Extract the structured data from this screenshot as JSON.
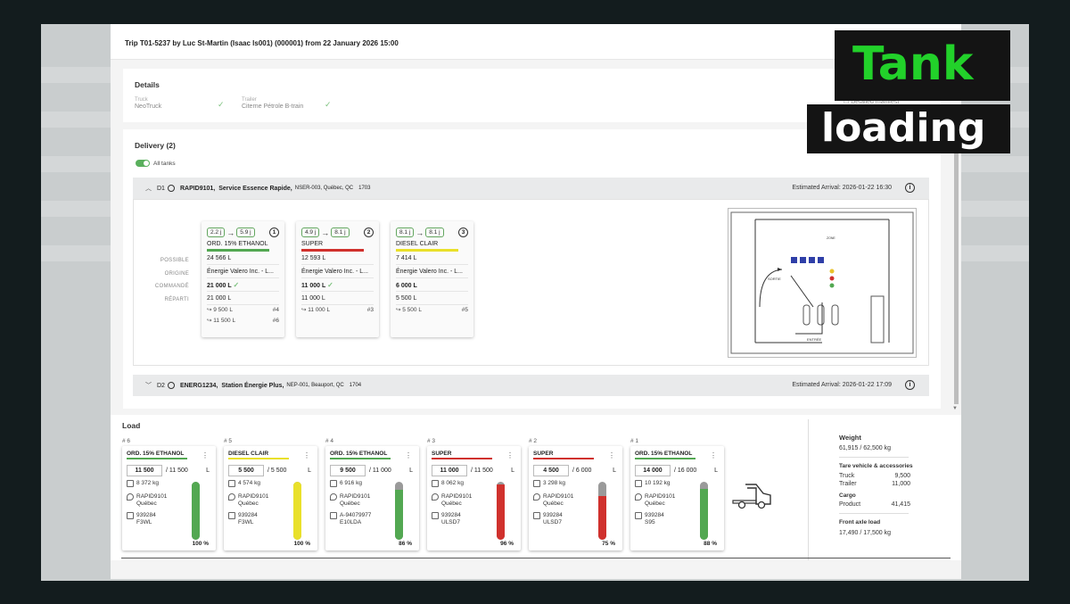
{
  "title": "Trip T01-5237 by Luc St-Martin (Isaac ls001) (000001) from 22 January 2026 15:00",
  "details": {
    "heading": "Details",
    "truck_label": "Truck",
    "truck_value": "NeoTruck",
    "trailer_label": "Trailer",
    "trailer_value": "Citerne Pétrole B-train",
    "manifest": "Detailed manifest"
  },
  "delivery": {
    "heading": "Delivery (2)",
    "all_tanks": "All tanks",
    "d1": {
      "id": "D1",
      "code": "RAPID9101,",
      "name": "Service Essence Rapide,",
      "address": "NSER-003, Québec, QC",
      "num": "1703",
      "eta": "Estimated Arrival: 2026-01-22 16:30"
    },
    "d2": {
      "id": "D2",
      "code": "ENERG1234,",
      "name": "Station Énergie Plus,",
      "address": "NEP-001, Beauport, QC",
      "num": "1704",
      "eta": "Estimated Arrival: 2026-01-22 17:09"
    },
    "row_labels": {
      "possible": "POSSIBLE",
      "origin": "ORIGINE",
      "ordered": "COMMANDÉ",
      "distributed": "RÉPARTI"
    },
    "tanks": [
      {
        "from": "2.2 j",
        "to": "5.9 j",
        "no": "1",
        "product": "ORD. 15% ETHANOL",
        "color": "#53a852",
        "possible": "24 566 L",
        "origin": "Énergie Valero Inc. - L...",
        "ordered": "21 000 L",
        "ordered_ok": "✓",
        "distributed": "21 000 L",
        "splits": [
          {
            "qty": "9 500 L",
            "tag": "#4"
          },
          {
            "qty": "11 500 L",
            "tag": "#6"
          }
        ]
      },
      {
        "from": "4.9 j",
        "to": "8.1 j",
        "no": "2",
        "product": "SUPER",
        "color": "#d0312d",
        "possible": "12 593 L",
        "origin": "Énergie Valero Inc. - L...",
        "ordered": "11 000 L",
        "ordered_ok": "✓",
        "distributed": "11 000 L",
        "splits": [
          {
            "qty": "11 000 L",
            "tag": "#3"
          }
        ]
      },
      {
        "from": "8.1 j",
        "to": "8.1 j",
        "no": "3",
        "product": "DIESEL CLAIR",
        "color": "#e9e02a",
        "possible": "7 414 L",
        "origin": "Énergie Valero Inc. - L...",
        "ordered": "6 000 L",
        "ordered_ok": "",
        "distributed": "5 500 L",
        "splits": [
          {
            "qty": "5 500 L",
            "tag": "#5"
          }
        ]
      }
    ],
    "map_labels": {
      "in": "ENTRÉE",
      "out": "SORTIE",
      "ref": "ZONE"
    }
  },
  "load": {
    "heading": "Load",
    "compartments": [
      {
        "num": "# 6",
        "product": "ORD. 15% ETHANOL",
        "color": "#53a852",
        "qty": "11 500",
        "cap": "/ 11 500",
        "unit": "L",
        "kg": "8 372 kg",
        "site": "RAPID9101",
        "city": "Québec",
        "doc": "939284",
        "code": "F3WL",
        "pct": "100 %",
        "level": 1.0
      },
      {
        "num": "# 5",
        "product": "DIESEL CLAIR",
        "color": "#e9e02a",
        "qty": "5 500",
        "cap": "/ 5 500",
        "unit": "L",
        "kg": "4 574 kg",
        "site": "RAPID9101",
        "city": "Québec",
        "doc": "939284",
        "code": "F3WL",
        "pct": "100 %",
        "level": 1.0
      },
      {
        "num": "# 4",
        "product": "ORD. 15% ETHANOL",
        "color": "#53a852",
        "qty": "9 500",
        "cap": "/ 11 000",
        "unit": "L",
        "kg": "6 916 kg",
        "site": "RAPID9101",
        "city": "Québec",
        "doc": "A-94079977",
        "code": "E10LDA",
        "pct": "86 %",
        "level": 0.86
      },
      {
        "num": "# 3",
        "product": "SUPER",
        "color": "#d0312d",
        "qty": "11 000",
        "cap": "/ 11 500",
        "unit": "L",
        "kg": "8 062 kg",
        "site": "RAPID9101",
        "city": "Québec",
        "doc": "939284",
        "code": "ULSD7",
        "pct": "96 %",
        "level": 0.96
      },
      {
        "num": "# 2",
        "product": "SUPER",
        "color": "#d0312d",
        "qty": "4 500",
        "cap": "/ 6 000",
        "unit": "L",
        "kg": "3 298 kg",
        "site": "RAPID9101",
        "city": "Québec",
        "doc": "939284",
        "code": "ULSD7",
        "pct": "75 %",
        "level": 0.75
      },
      {
        "num": "# 1",
        "product": "ORD. 15% ETHANOL",
        "color": "#53a852",
        "qty": "14 000",
        "cap": "/ 16 000",
        "unit": "L",
        "kg": "10 192 kg",
        "site": "RAPID9101",
        "city": "Québec",
        "doc": "939284",
        "code": "S95",
        "pct": "88 %",
        "level": 0.88
      }
    ]
  },
  "weight": {
    "heading": "Weight",
    "total": "61,915 / 62,500 kg",
    "tare_heading": "Tare vehicle & accessories",
    "truck_label": "Truck",
    "truck": "9,500",
    "trailer_label": "Trailer",
    "trailer": "11,000",
    "cargo_heading": "Cargo",
    "product_label": "Product",
    "product": "41,415",
    "axle_heading": "Front axle load",
    "axle": "17,490 / 17,500 kg"
  },
  "overlay": {
    "line1": "Tank",
    "line2": "loading",
    "line1_color": "#22d12a",
    "line2_color": "#ffffff"
  }
}
